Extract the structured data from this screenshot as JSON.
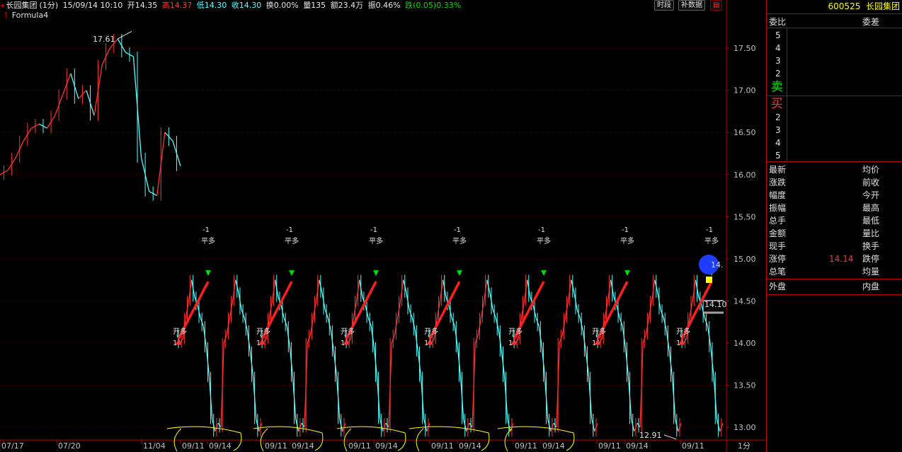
{
  "header": {
    "stock": "长园集团",
    "period": "(1分)",
    "datetime": "15/09/14 10:10",
    "open": "开14.35",
    "high": "高14.37",
    "low": "低14.30",
    "close": "收14.30",
    "turnover": "换0.00%",
    "volume": "量135",
    "amount": "额23.4万",
    "amplitude": "振0.46%",
    "change": "跌(0.05)0.33%"
  },
  "buttons": {
    "time_segment": "时段",
    "supplement": "补数据"
  },
  "formula": "Formula4",
  "panel": {
    "code": "600525",
    "name": "长园集团",
    "weibi": "委比",
    "weicha": "委差",
    "sell_levels": [
      "5",
      "4",
      "3",
      "2"
    ],
    "sell_label": "卖",
    "buy_label": "买",
    "buy_levels": [
      "2",
      "3",
      "4",
      "5"
    ],
    "quote_rows": [
      {
        "left": "最新",
        "right": "均价",
        "value": ""
      },
      {
        "left": "涨跌",
        "right": "前收",
        "value": ""
      },
      {
        "left": "幅度",
        "right": "今开",
        "value": ""
      },
      {
        "left": "振幅",
        "right": "最高",
        "value": ""
      },
      {
        "left": "总手",
        "right": "最低",
        "value": ""
      },
      {
        "left": "金额",
        "right": "量比",
        "value": ""
      },
      {
        "left": "现手",
        "right": "换手",
        "value": ""
      },
      {
        "left": "涨停",
        "right": "跌停",
        "value": "14.14"
      },
      {
        "left": "总笔",
        "right": "均量",
        "value": ""
      }
    ],
    "outer": "外盘",
    "inner": "内盘"
  },
  "chart_data": {
    "type": "line",
    "title": "",
    "ylim": [
      12.85,
      17.82
    ],
    "y_ticks": [
      "17.50",
      "17.00",
      "16.50",
      "16.00",
      "15.50",
      "15.00",
      "14.50",
      "14.00",
      "13.50",
      "13.00"
    ],
    "x_tick_labels": [
      "07/17",
      "07/20",
      "11/04",
      "09/11",
      "09/14",
      "09/11",
      "09/14",
      "09/11",
      "09/14",
      "09/11",
      "09/14",
      "09/11",
      "09/14",
      "09/11",
      "09/14",
      "09/11"
    ],
    "period_label": "1分",
    "annotations": {
      "high_label": "17.61",
      "low_label": "12.91",
      "price_tag_top": "14.",
      "price_tag_bottom": "14.10",
      "signal_top_minus": "-1",
      "signal_top_label": "平多",
      "signal_bottom_label": "开多",
      "signal_bottom_one": "1"
    },
    "series": [
      {
        "values": [
          16.0,
          16.05,
          16.2,
          16.4,
          16.55,
          16.6,
          16.55,
          16.7,
          16.95,
          17.2,
          16.9,
          17.0,
          16.7,
          17.3,
          17.5,
          17.61,
          17.45,
          17.4,
          16.2,
          15.8,
          15.75,
          16.5,
          16.4,
          16.1
        ]
      },
      {
        "values": [
          14.1,
          14.0,
          14.05,
          14.3,
          14.5,
          14.75,
          14.55,
          14.45,
          14.3,
          14.2,
          13.95,
          13.6,
          13.1,
          12.95,
          13.05,
          13.0,
          14.0,
          14.1,
          14.3,
          14.5,
          14.75,
          14.6,
          14.4,
          14.3,
          14.15,
          13.9,
          13.6,
          13.1,
          12.95,
          13.05
        ]
      }
    ],
    "trade_lines": [
      {
        "from": 14.05,
        "to": 14.73
      },
      {
        "from": 14.05,
        "to": 14.73
      },
      {
        "from": 14.05,
        "to": 14.73
      },
      {
        "from": 14.05,
        "to": 14.73
      },
      {
        "from": 14.05,
        "to": 14.73
      },
      {
        "from": 14.05,
        "to": 14.73
      },
      {
        "from": 14.05,
        "to": 14.73
      }
    ]
  },
  "colors": {
    "up": "#ff3232",
    "down": "#54ffff",
    "axis": "#c00000",
    "signal_up": "#00e000",
    "annotation": "#ffff00"
  }
}
